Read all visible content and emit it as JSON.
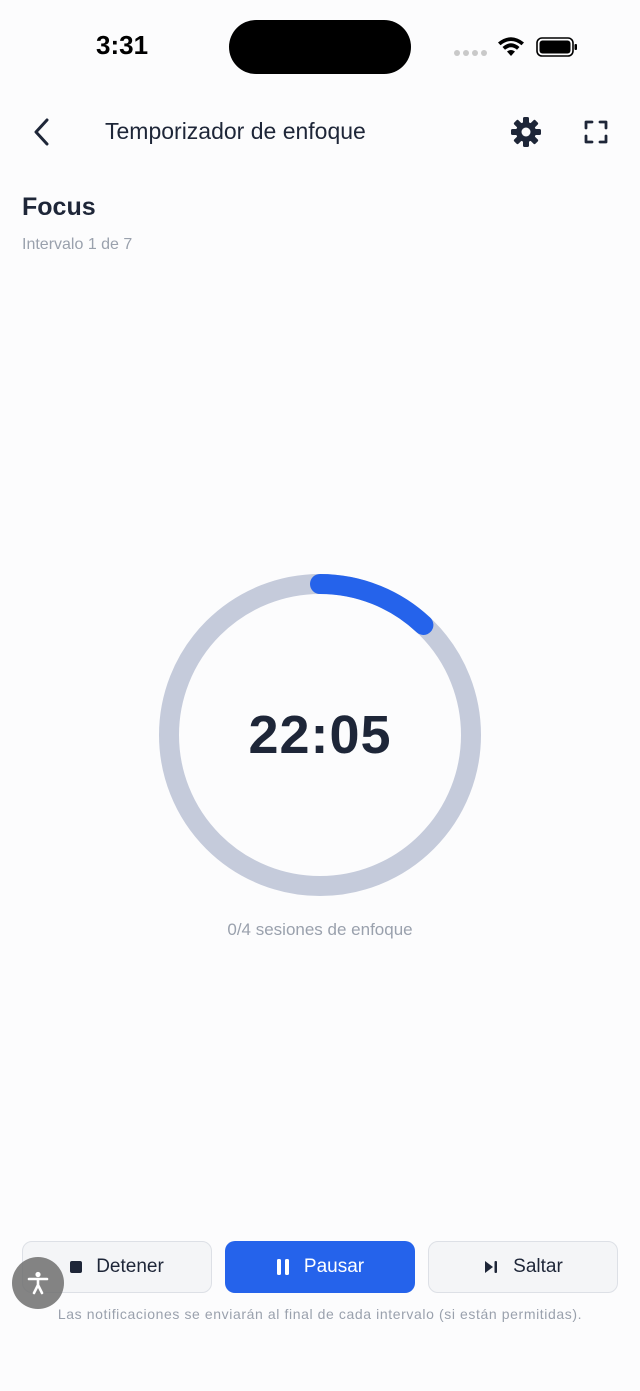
{
  "status_bar": {
    "time": "3:31"
  },
  "header": {
    "title": "Temporizador de enfoque"
  },
  "interval": {
    "name": "Focus",
    "subtitle": "Intervalo 1 de 7"
  },
  "timer": {
    "remaining": "22:05",
    "progress": 0.12,
    "sessions_label": "0/4 sesiones de enfoque"
  },
  "controls": {
    "stop_label": "Detener",
    "pause_label": "Pausar",
    "skip_label": "Saltar"
  },
  "notice": "Las notificaciones se enviarán al final de cada intervalo (si están permitidas).",
  "colors": {
    "accent": "#2563eb",
    "ring_track": "#c5cbdb",
    "text": "#1e2638",
    "muted": "#9aa1ad"
  },
  "icons": [
    "chevron-left-icon",
    "gear-icon",
    "fullscreen-icon",
    "stop-icon",
    "pause-icon",
    "skip-icon",
    "accessibility-icon"
  ]
}
